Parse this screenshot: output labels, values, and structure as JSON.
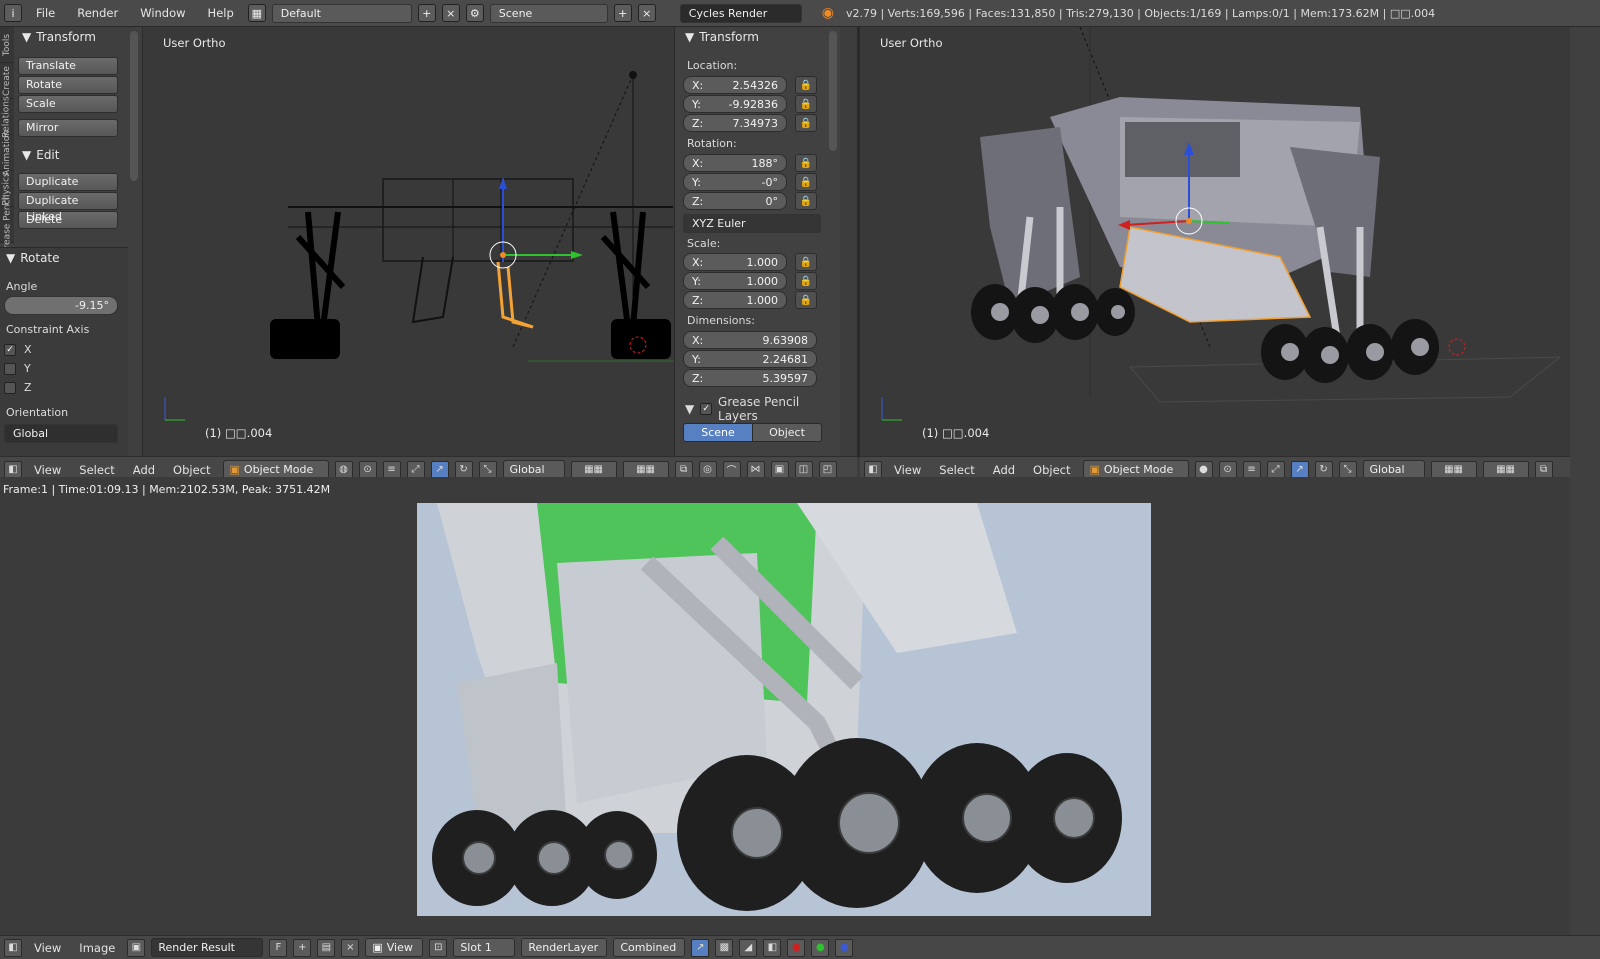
{
  "topbar": {
    "menus": [
      "File",
      "Render",
      "Window",
      "Help"
    ],
    "layout": "Default",
    "scene": "Scene",
    "engine": "Cycles Render",
    "stats": "v2.79 | Verts:169,596 | Faces:131,850 | Tris:279,130 | Objects:1/169 | Lamps:0/1 | Mem:173.62M | □□.004"
  },
  "toolshelf": {
    "tabs": [
      "Tools",
      "Create",
      "Relations",
      "Animation",
      "Physics",
      "Grease Pencil"
    ],
    "transform_title": "Transform",
    "transform_buttons": [
      "Translate",
      "Rotate",
      "Scale",
      "Mirror"
    ],
    "edit_title": "Edit",
    "edit_buttons": [
      "Duplicate",
      "Duplicate Linked",
      "Delete"
    ],
    "operator_title": "Rotate",
    "angle_label": "Angle",
    "angle_value": "-9.15°",
    "constraint_label": "Constraint Axis",
    "axes": [
      "X",
      "Y",
      "Z"
    ],
    "orientation_label": "Orientation",
    "orientation_value": "Global"
  },
  "viewport_left": {
    "view_label": "User Ortho",
    "object_label": "(1) □□.004"
  },
  "viewport_right": {
    "view_label": "User Ortho",
    "object_label": "(1) □□.004"
  },
  "npanel": {
    "title": "Transform",
    "location_label": "Location:",
    "location": {
      "x": "2.54326",
      "y": "-9.92836",
      "z": "7.34973"
    },
    "rotation_label": "Rotation:",
    "rotation": {
      "x": "188°",
      "y": "-0°",
      "z": "0°"
    },
    "rotation_mode": "XYZ Euler",
    "scale_label": "Scale:",
    "scale": {
      "x": "1.000",
      "y": "1.000",
      "z": "1.000"
    },
    "dimensions_label": "Dimensions:",
    "dimensions": {
      "x": "9.63908",
      "y": "2.24681",
      "z": "5.39597"
    },
    "grease_title": "Grease Pencil Layers",
    "grease_tabs": [
      "Scene",
      "Object"
    ],
    "axis_x": "X:",
    "axis_y": "Y:",
    "axis_z": "Z:"
  },
  "header_left": {
    "menus": [
      "View",
      "Select",
      "Add",
      "Object"
    ],
    "mode": "Object Mode",
    "orientation": "Global"
  },
  "header_right": {
    "menus": [
      "View",
      "Select",
      "Add",
      "Object"
    ],
    "mode": "Object Mode",
    "orientation": "Global"
  },
  "render_info": "Frame:1 | Time:01:09.13 | Mem:2102.53M, Peak: 3751.42M",
  "footer": {
    "menus": [
      "View",
      "Image"
    ],
    "image_name": "Render Result",
    "fake_user": "F",
    "view_label": "View",
    "slot": "Slot 1",
    "layer": "RenderLayer",
    "pass": "Combined"
  }
}
